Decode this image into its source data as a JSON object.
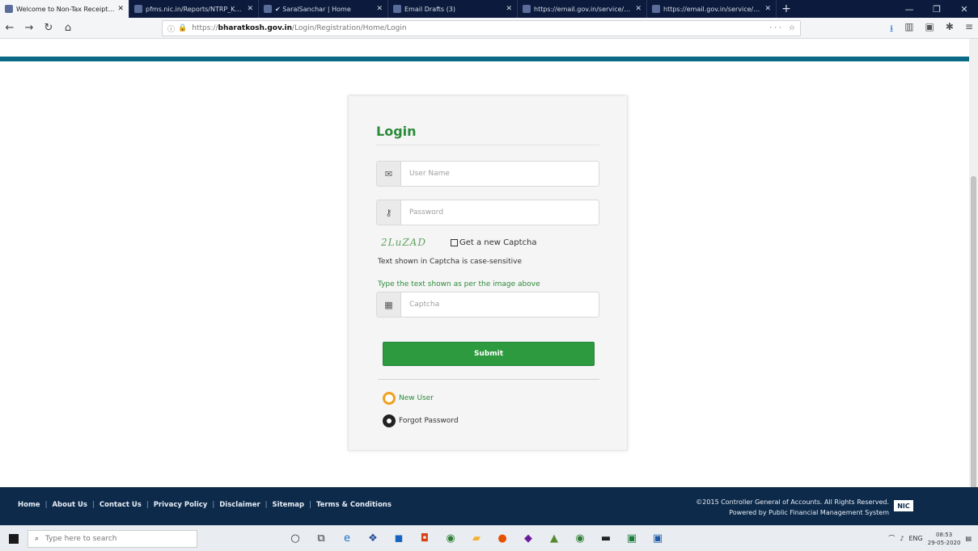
{
  "browser": {
    "tabs": [
      {
        "title": "Welcome to Non-Tax Receipt Por...",
        "active": true
      },
      {
        "title": "pfms.nic.in/Reports/NTRP_Know..."
      },
      {
        "title": "✔ SaralSanchar | Home"
      },
      {
        "title": "Email Drafts (3)"
      },
      {
        "title": "https://email.gov.in/service/hom..."
      },
      {
        "title": "https://email.gov.in/service/hom..."
      }
    ],
    "new_tab": "+",
    "url_prefix": "https://",
    "url_host": "bharatkosh.gov.in",
    "url_path": "/Login/Registration/Home/Login",
    "url_more": "···"
  },
  "login": {
    "title": "Login",
    "username_placeholder": "User Name",
    "password_placeholder": "Password",
    "captcha_image_text": "2LuZAD",
    "refresh_label": "Get a new Captcha",
    "case_note": "Text shown in Captcha is case-sensitive",
    "captcha_hint": "Type the text shown as per the image above",
    "captcha_placeholder": "Captcha",
    "submit_label": "Submit",
    "new_user_label": "New User",
    "forgot_password_label": "Forgot Password"
  },
  "footer": {
    "links": [
      "Home",
      "About Us",
      "Contact Us",
      "Privacy Policy",
      "Disclaimer",
      "Sitemap",
      "Terms & Conditions"
    ],
    "copyright": "©2015 Controller General of Accounts. All Rights Reserved.",
    "powered_by": "Powered by  Public Financial Management System",
    "logo_text": "NIC"
  },
  "taskbar": {
    "search_placeholder": "Type here to search",
    "tray_lang": "ENG",
    "time": "08:53",
    "date": "29-05-2020"
  },
  "colors": {
    "accent_green": "#2e9a3f",
    "footer_bg": "#0d2a4a",
    "header_stripe": "#0b6a86"
  }
}
